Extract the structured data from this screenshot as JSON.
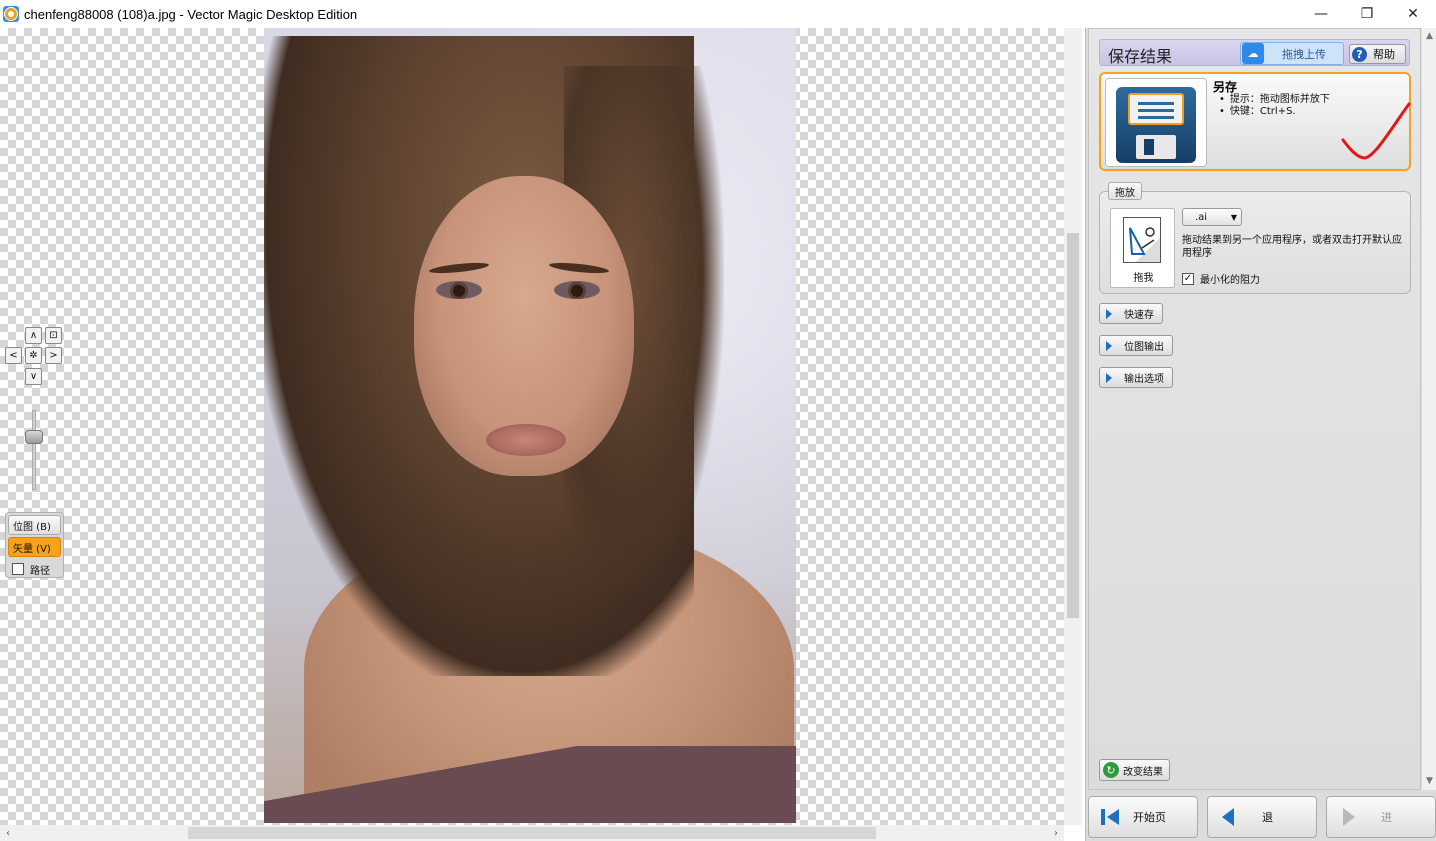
{
  "window": {
    "title": "chenfeng88008 (108)a.jpg - Vector Magic Desktop Edition",
    "minimize": "—",
    "maximize": "❐",
    "close": "✕"
  },
  "nav_pad": {
    "up": "∧",
    "down": "∨",
    "left": "<",
    "right": ">",
    "center": "✲",
    "fit": "⊡"
  },
  "zoom": {
    "level": 0.7
  },
  "modes": {
    "bitmap": "位图 (B)",
    "vector": "矢量 (V)",
    "path": "路径",
    "path_checked": false
  },
  "panel": {
    "header_title": "保存结果",
    "upload_label": "拖拽上传",
    "help_label": "帮助",
    "save_as": {
      "title": "另存",
      "tip1": "提示：拖动图标并放下",
      "tip2": "快键：Ctrl+S."
    },
    "drag_drop": {
      "tag": "拖放",
      "icon_caption": "拖我",
      "format": ".ai",
      "description": "拖动结果到另一个应用程序，或者双击打开默认应用程序",
      "min_resistance": "最小化的阻力",
      "min_resistance_checked": true
    },
    "quick_save": "快速存",
    "bitmap_output": "位图输出",
    "output_options": "输出选项",
    "change_result": "改变结果",
    "nav": {
      "start": "开始页",
      "back": "退",
      "forward": "进"
    }
  },
  "colors": {
    "accent_orange": "#f7a21b",
    "header_purple": "#c7c4e4",
    "upload_blue": "#2d8ae6"
  }
}
